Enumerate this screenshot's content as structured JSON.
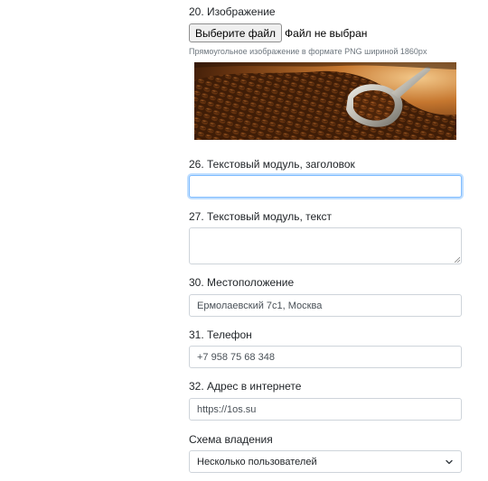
{
  "image_field": {
    "label": "20. Изображение",
    "choose_button": "Выберите файл",
    "file_status": "Файл не выбран",
    "hint": "Прямоугольное изображение в формате PNG шириной 1860px",
    "preview_icon": "coffee-beans-photo"
  },
  "text_module_title": {
    "label": "26. Текстовый модуль, заголовок",
    "value": ""
  },
  "text_module_text": {
    "label": "27. Текстовый модуль, текст",
    "value": ""
  },
  "location": {
    "label": "30. Местоположение",
    "value": "Ермолаевский 7с1, Москва"
  },
  "phone": {
    "label": "31. Телефон",
    "value": "+7 958 75 68 348"
  },
  "website": {
    "label": "32. Адрес в интернете",
    "value": "https://1os.su"
  },
  "ownership": {
    "label": "Схема владения",
    "selected": "Несколько пользователей"
  },
  "colors": {
    "focus_border": "#80bdff",
    "input_border": "#ced4da",
    "hint_text": "#6c757d"
  }
}
